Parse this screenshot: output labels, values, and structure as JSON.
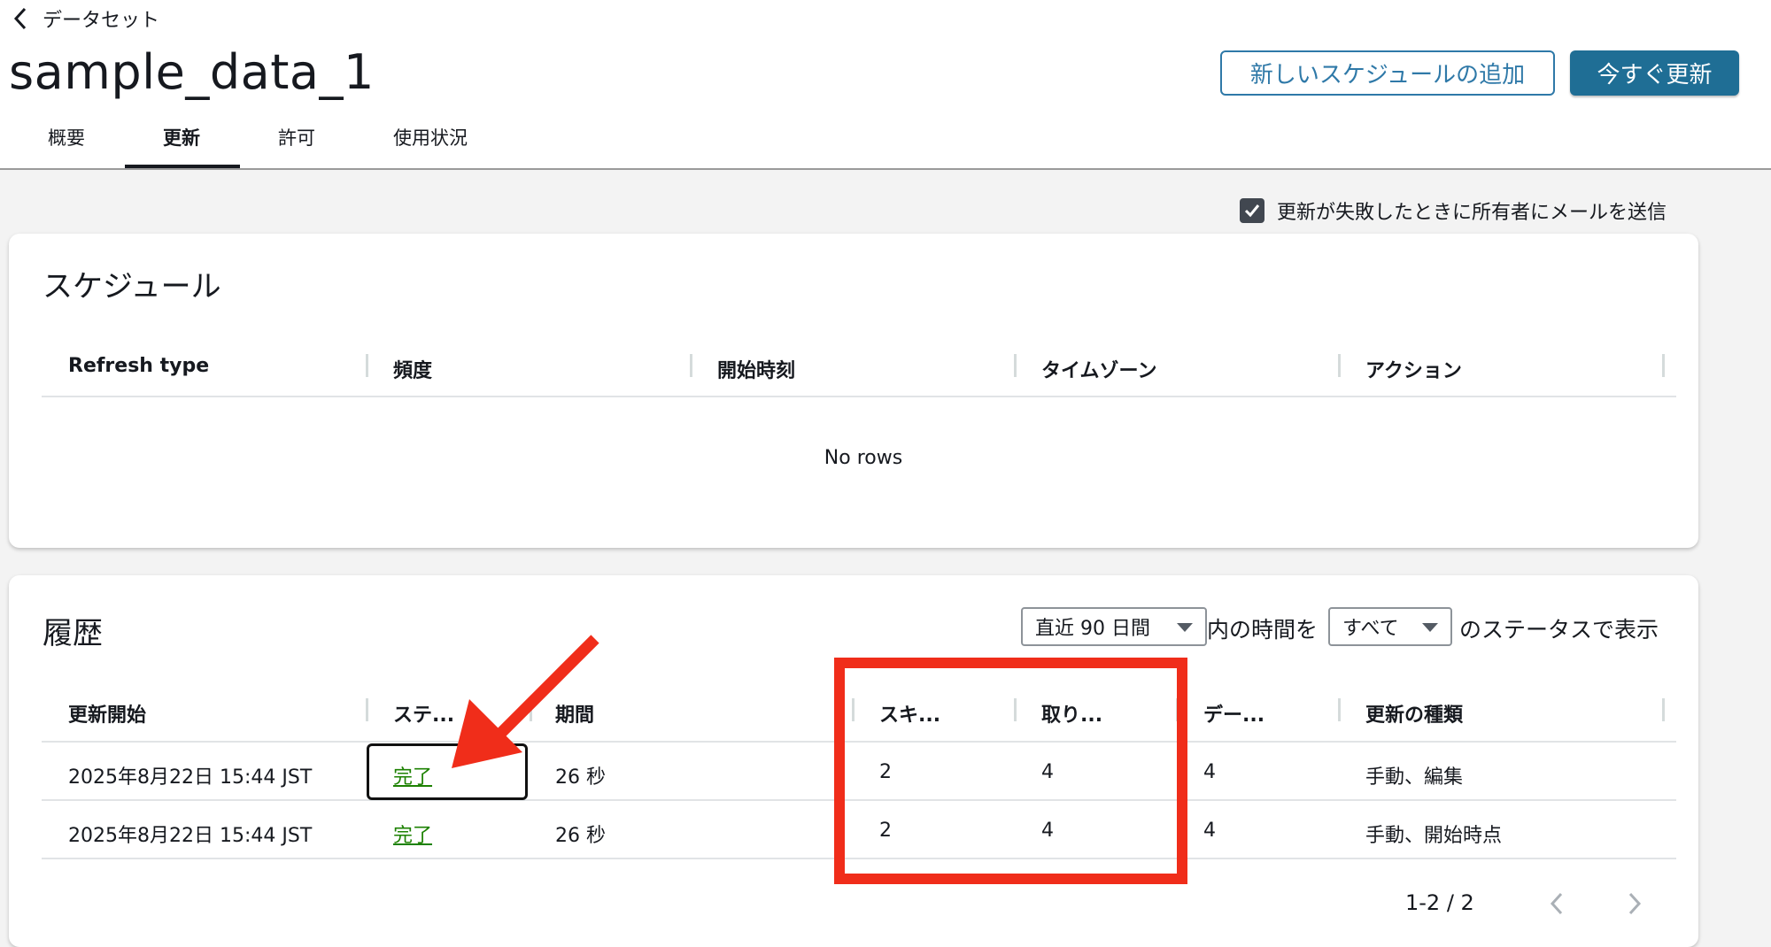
{
  "breadcrumb": {
    "back_label": "データセット"
  },
  "page": {
    "title": "sample_data_1"
  },
  "actions": {
    "add_schedule": "新しいスケジュールの追加",
    "refresh_now": "今すぐ更新"
  },
  "tabs": [
    {
      "label": "概要",
      "active": false
    },
    {
      "label": "更新",
      "active": true
    },
    {
      "label": "許可",
      "active": false
    },
    {
      "label": "使用状況",
      "active": false
    }
  ],
  "email_option": {
    "label": "更新が失敗したときに所有者にメールを送信",
    "checked": true
  },
  "schedule": {
    "title": "スケジュール",
    "columns": [
      "Refresh type",
      "頻度",
      "開始時刻",
      "タイムゾーン",
      "アクション"
    ],
    "empty_text": "No rows"
  },
  "history": {
    "title": "履歴",
    "filter": {
      "period_value": "直近 90 日間",
      "mid_text": "内の時間を",
      "status_value": "すべて",
      "end_text": "のステータスで表示"
    },
    "columns": [
      "更新開始",
      "ステ...",
      "期間",
      "スキ...",
      "取り...",
      "デー...",
      "更新の種類"
    ],
    "rows": [
      {
        "start": "2025年8月22日 15:44 JST",
        "status": "完了",
        "duration": "26 秒",
        "skipped": "2",
        "ingested": "4",
        "dataset": "4",
        "type": "手動、編集"
      },
      {
        "start": "2025年8月22日 15:44 JST",
        "status": "完了",
        "duration": "26 秒",
        "skipped": "2",
        "ingested": "4",
        "dataset": "4",
        "type": "手動、開始時点"
      }
    ],
    "pagination": {
      "range": "1-2 / 2"
    }
  },
  "colors": {
    "primary": "#1f6e95",
    "link_green": "#1d8102",
    "highlight_red": "#f02d1a"
  },
  "icons": [
    "chevron-left-icon",
    "checkmark-icon",
    "caret-down-icon",
    "chevron-right-icon",
    "arrow-annotation"
  ]
}
